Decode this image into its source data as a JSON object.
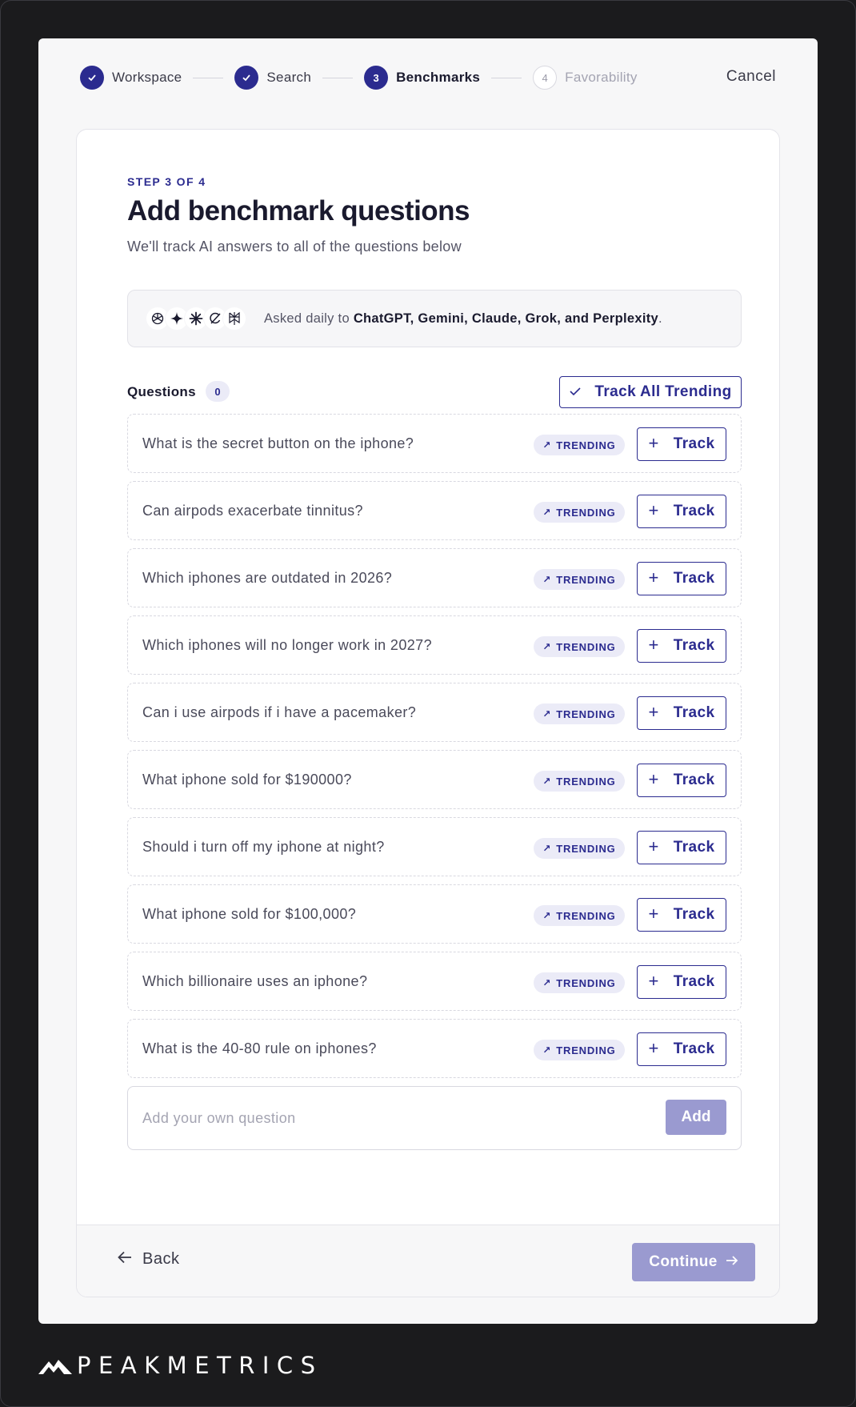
{
  "stepper": {
    "steps": [
      {
        "label": "Workspace",
        "number": "✓",
        "state": "done"
      },
      {
        "label": "Search",
        "number": "✓",
        "state": "done"
      },
      {
        "label": "Benchmarks",
        "number": "3",
        "state": "active"
      },
      {
        "label": "Favorability",
        "number": "4",
        "state": "pending"
      }
    ],
    "cancel_label": "Cancel"
  },
  "header": {
    "eyebrow": "STEP 3 OF 4",
    "title": "Add benchmark questions",
    "subtitle": "We'll track AI answers to all of the questions below"
  },
  "models": {
    "prefix": "Asked daily to ",
    "names": "ChatGPT, Gemini, Claude, Grok, and Perplexity",
    "suffix": ".",
    "icons": [
      "chatgpt-icon",
      "gemini-icon",
      "claude-icon",
      "grok-icon",
      "perplexity-icon"
    ]
  },
  "questions": {
    "title": "Questions",
    "count": "0",
    "track_all_label": "Track All Trending",
    "badge_label": "TRENDING",
    "track_label": "Track",
    "items": [
      "What is the secret button on the iphone?",
      "Can airpods exacerbate tinnitus?",
      "Which iphones are outdated in 2026?",
      "Which iphones will no longer work in 2027?",
      "Can i use airpods if i have a pacemaker?",
      "What iphone sold for $190000?",
      "Should i turn off my iphone at night?",
      "What iphone sold for $100,000?",
      "Which billionaire uses an iphone?",
      "What is the 40-80 rule on iphones?"
    ],
    "add_placeholder": "Add your own question",
    "add_label": "Add"
  },
  "footer": {
    "back_label": "Back",
    "continue_label": "Continue"
  },
  "brand": {
    "name": "PEAKMETRICS",
    "accent": "#2b2b8f",
    "disabled": "#9a9ad0"
  }
}
